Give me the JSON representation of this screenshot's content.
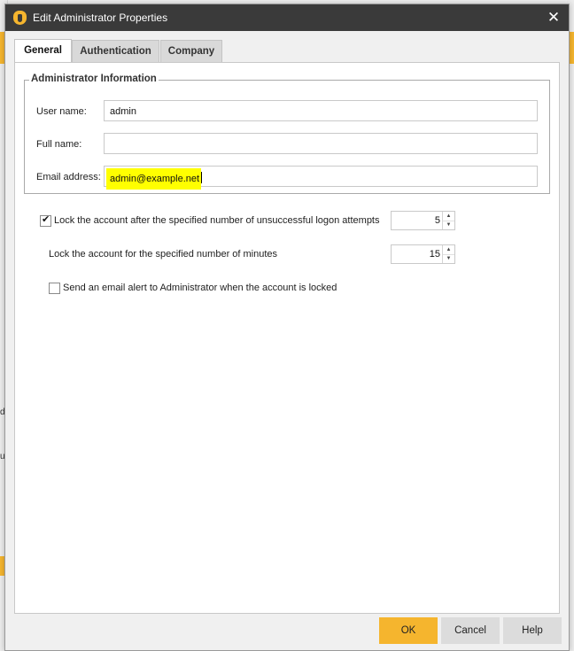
{
  "window": {
    "title": "Edit Administrator Properties",
    "logo_icon": "shield-icon",
    "close_icon": "close-icon",
    "close_glyph": "✕"
  },
  "tabs": [
    {
      "label": "General",
      "active": true
    },
    {
      "label": "Authentication",
      "active": false
    },
    {
      "label": "Company",
      "active": false
    }
  ],
  "admin_info": {
    "group_title": "Administrator Information",
    "username_label": "User name:",
    "username_value": "admin",
    "fullname_label": "Full name:",
    "fullname_value": "",
    "email_label": "Email address:",
    "email_value": "admin@example.net"
  },
  "lockout": {
    "lock_attempts_checked": true,
    "lock_attempts_label": "Lock the account after the specified number of unsuccessful logon attempts",
    "attempts_value": "5",
    "lock_minutes_label": "Lock the account for the specified number of minutes",
    "minutes_value": "15",
    "email_alert_checked": false,
    "email_alert_label": "Send an email alert to Administrator when the account is locked",
    "check_glyph": "✔",
    "spin_up_glyph": "▲",
    "spin_down_glyph": "▼"
  },
  "buttons": {
    "ok": "OK",
    "cancel": "Cancel",
    "help": "Help"
  },
  "background": {
    "left_chars": [
      "d",
      "u"
    ]
  },
  "colors": {
    "accent": "#f5b52e",
    "titlebar": "#3a3a3a",
    "highlight": "#ffff00"
  }
}
